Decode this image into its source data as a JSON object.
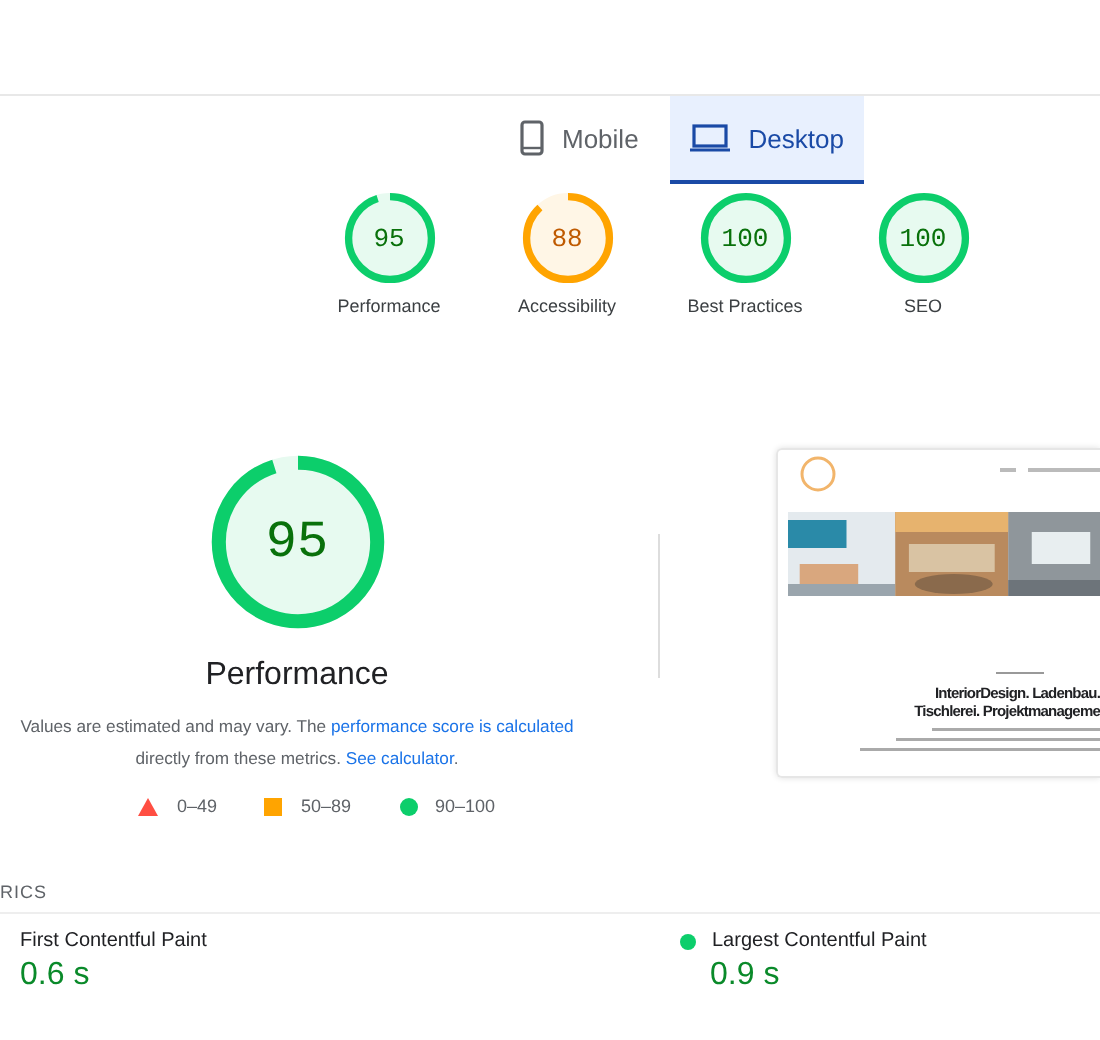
{
  "tabs": [
    {
      "label": "Mobile",
      "kind": "mobile",
      "selected": false
    },
    {
      "label": "Desktop",
      "kind": "desktop",
      "selected": true
    }
  ],
  "gauges": [
    {
      "score": "95",
      "label": "Performance",
      "color": "#0cce6b",
      "level": 0.95
    },
    {
      "score": "88",
      "label": "Accessibility",
      "color": "#ffa400",
      "level": 0.88
    },
    {
      "score": "100",
      "label": "Best Practices",
      "color": "#0cce6b",
      "level": 1
    },
    {
      "score": "100",
      "label": "SEO",
      "color": "#0cce6b",
      "level": 1
    }
  ],
  "performance": {
    "score": "95",
    "color": "#0cce6b",
    "level": 0.95,
    "title": "Performance",
    "note": [
      {
        "text": "Values are estimated and may vary. The ",
        "link": false
      },
      {
        "text": "performance score is calculated",
        "link": true
      },
      {
        "text": " directly from these metrics. ",
        "link": false
      },
      {
        "text": "See calculator",
        "link": true
      },
      {
        "text": ".",
        "link": false
      }
    ],
    "legend": [
      {
        "kind": "fail",
        "range": "0–49"
      },
      {
        "kind": "average",
        "range": "50–89"
      },
      {
        "kind": "pass",
        "range": "90–100"
      }
    ],
    "screenshot": {
      "headline": [
        "InteriorDesign. Ladenbau.",
        "Tischlerei. Projektmanageme"
      ]
    }
  },
  "metrics": {
    "heading": "RICS",
    "items": [
      {
        "name": "First Contentful Paint",
        "value": "0.6 s"
      },
      {
        "name": "Largest Contentful Paint",
        "value": "0.9 s",
        "color": "#0cce6b"
      }
    ]
  }
}
